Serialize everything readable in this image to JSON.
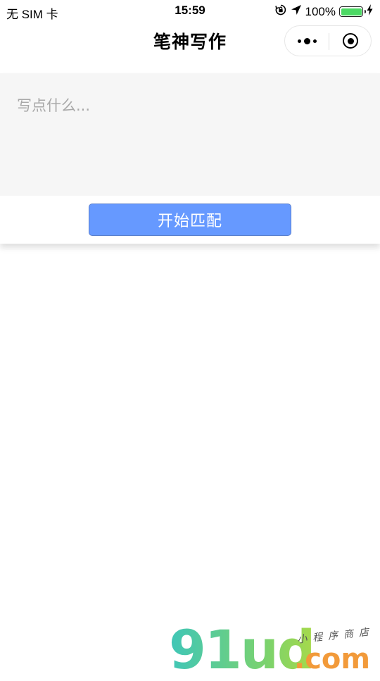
{
  "status_bar": {
    "carrier": "无 SIM 卡",
    "time": "15:59",
    "battery_percent": "100%",
    "battery_level": 1.0,
    "battery_color": "#4cd964",
    "icons": [
      "rotation-lock-icon",
      "location-arrow-icon",
      "battery-icon",
      "charging-bolt-icon"
    ]
  },
  "nav": {
    "title": "笔神写作",
    "more_icon": "more-dots-icon",
    "close_icon": "target-circle-icon"
  },
  "editor": {
    "placeholder": "写点什么...",
    "value": "",
    "button_label": "开始匹配",
    "button_color": "#6699ff",
    "textarea_bg": "#f6f6f6"
  },
  "watermark": {
    "logo_text": "91ud",
    "domain_text": ".com",
    "tagline": "小程序商店"
  }
}
